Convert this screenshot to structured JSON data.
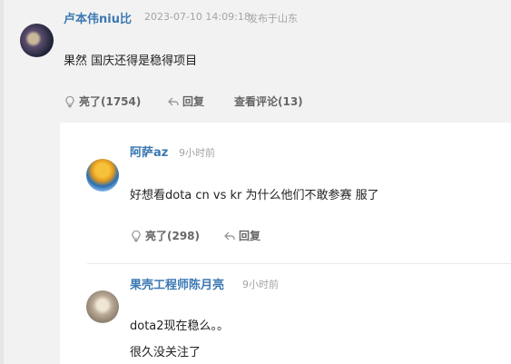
{
  "main_comment": {
    "username": "卢本伟niu比",
    "timestamp": "2023-07-10 14:09:18",
    "location": "发布于山东",
    "text": "果然 国庆还得是稳得项目",
    "like_label": "亮了(1754)",
    "reply_label": "回复",
    "view_label": "查看评论(13)"
  },
  "replies": [
    {
      "username": "阿萨az",
      "time": "9小时前",
      "text": "好想看dota  cn vs kr 为什么他们不敢参赛  服了",
      "like_label": "亮了(298)",
      "reply_label": "回复"
    },
    {
      "username": "果壳工程师陈月亮",
      "time": "9小时前",
      "text_line1": "dota2现在稳么。。",
      "text_line2": "很久没关注了"
    }
  ],
  "icons": {
    "like": "lightbulb-icon",
    "reply": "reply-arrow-icon"
  }
}
